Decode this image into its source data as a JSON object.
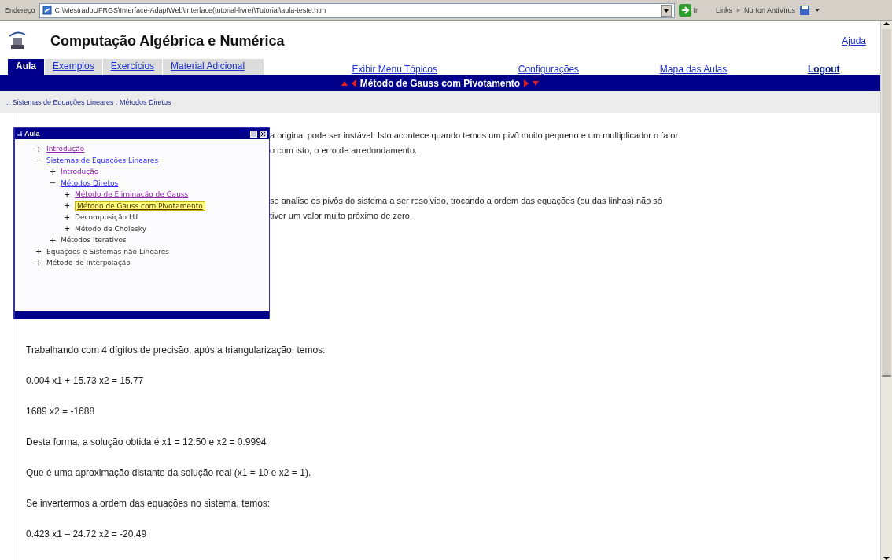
{
  "address_bar": {
    "label": "Endereço",
    "url": "C:\\MestradoUFRGS\\Interface-AdaptWeb\\Interface(tutorial-livre)\\Tutorial\\aula-teste.htm",
    "go": "Ir",
    "links": "Links",
    "more": "»",
    "toolbar": "Norton AntiVirus"
  },
  "header": {
    "title": "Computação Algébrica e Numérica",
    "help": "Ajuda"
  },
  "tabs": [
    {
      "label": "Aula",
      "selected": true
    },
    {
      "label": "Exemplos",
      "selected": false
    },
    {
      "label": "Exercícios",
      "selected": false
    },
    {
      "label": "Material Adicional",
      "selected": false
    }
  ],
  "nav_links": [
    {
      "label": "Exibir Menu Tópicos",
      "bold": false
    },
    {
      "label": "Configurações",
      "bold": false
    },
    {
      "label": "Mapa das Aulas",
      "bold": false
    },
    {
      "label": "Logout",
      "bold": true
    }
  ],
  "lesson_bar": {
    "title": "Método de Gauss com Pivotamento"
  },
  "breadcrumb": ":: Sistemas de Equações Lineares : Métodos Diretos",
  "topics_window": {
    "title": "Aula",
    "items": [
      {
        "toggle": "+",
        "label": "Introdução",
        "kind": "visited",
        "selected": false
      },
      {
        "toggle": "−",
        "label": "Sistemas de Equações Lineares",
        "kind": "link",
        "selected": false,
        "children": [
          {
            "toggle": "+",
            "label": "Introdução",
            "kind": "visited",
            "selected": false
          },
          {
            "toggle": "−",
            "label": "Métodos Diretos",
            "kind": "link",
            "selected": false,
            "children": [
              {
                "toggle": "+",
                "label": "Método de Eliminação de Gauss",
                "kind": "visited",
                "selected": false
              },
              {
                "toggle": "+",
                "label": "Método de Gauss com Pivotamento",
                "kind": "link",
                "selected": true
              },
              {
                "toggle": "+",
                "label": "Decomposição LU",
                "kind": "text",
                "selected": false
              },
              {
                "toggle": "+",
                "label": "Método de Cholesky",
                "kind": "text",
                "selected": false
              }
            ]
          },
          {
            "toggle": "+",
            "label": "Métodos Iterativos",
            "kind": "text",
            "selected": false
          }
        ]
      },
      {
        "toggle": "+",
        "label": "Equações e Sistemas não Lineares",
        "kind": "text",
        "selected": false
      },
      {
        "toggle": "+",
        "label": "Método de Interpolação",
        "kind": "text",
        "selected": false
      }
    ]
  },
  "partial_paragraphs": [
    [
      "a original pode ser instável. Isto acontece quando temos um pivô muito pequeno e um multiplicador o fator",
      "o com isto, o erro de arredondamento."
    ],
    [
      "se analise os pivôs do sistema a ser resolvido, trocando a ordem das equações (ou das linhas) não só",
      "tiver um valor muito próximo de zero."
    ]
  ],
  "paragraphs": [
    "Trabalhando com 4 dígitos de precisão, após a triangularização, temos:",
    "0.004 x1  + 15.73 x2 = 15.77",
    "1689 x2 = -1688",
    "Desta forma, a solução obtida é x1 = 12.50 e x2 = 0.9994",
    "Que é uma aproximação distante da solução real (x1 = 10 e x2 = 1).",
    "Se invertermos a ordem das equações no sistema, temos:",
    "0.423 x1 – 24.72 x2 = -20.49"
  ]
}
